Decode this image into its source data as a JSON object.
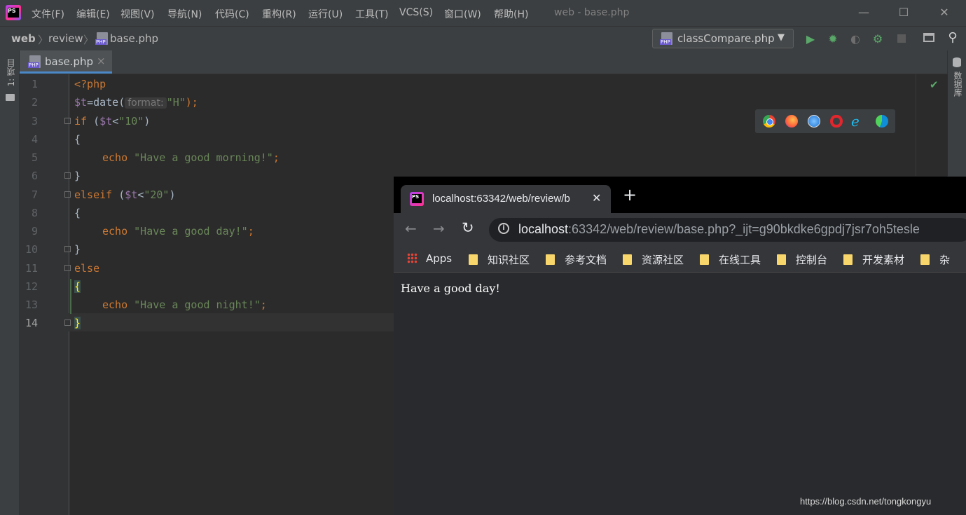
{
  "window": {
    "title": "web - base.php",
    "logo_text": "PS",
    "controls": {
      "minimize": "—",
      "maximize": "☐",
      "close": "✕"
    }
  },
  "menu": [
    "文件(F)",
    "编辑(E)",
    "视图(V)",
    "导航(N)",
    "代码(C)",
    "重构(R)",
    "运行(U)",
    "工具(T)",
    "VCS(S)",
    "窗口(W)",
    "帮助(H)"
  ],
  "breadcrumb": {
    "project": "web",
    "folder": "review",
    "file": "base.php"
  },
  "run_config": {
    "label": "classCompare.php"
  },
  "toolbar_icons": [
    "run-icon",
    "debug-icon",
    "coverage-icon",
    "profile-icon",
    "stop-icon",
    "terminal-icon",
    "search-icon"
  ],
  "left_panel": {
    "label": "1: 项目"
  },
  "right_panel": {
    "label": "数据库"
  },
  "editor": {
    "tab": {
      "label": "base.php",
      "close": "×"
    },
    "lines": [
      "1",
      "2",
      "3",
      "4",
      "5",
      "6",
      "7",
      "8",
      "9",
      "10",
      "11",
      "12",
      "13",
      "14"
    ],
    "code": {
      "l1": "<?php",
      "l2_var": "$t",
      "l2_fn": "=date(",
      "l2_hint": "format:",
      "l2_str": "\"H\"",
      "l2_end": ");",
      "l3_kw": "if",
      "l3_open": " (",
      "l3_var": "$t",
      "l3_op": "<",
      "l3_str": "\"10\"",
      "l3_close": ")",
      "l4": "{",
      "l5_kw": "echo",
      "l5_str": "\"Have a good morning!\"",
      "l5_end": ";",
      "l6": "}",
      "l7_kw": "elseif",
      "l7_open": " (",
      "l7_var": "$t",
      "l7_op": "<",
      "l7_str": "\"20\"",
      "l7_close": ")",
      "l8": "{",
      "l9_kw": "echo",
      "l9_str": "\"Have a good day!\"",
      "l9_end": ";",
      "l10": "}",
      "l11_kw": "else",
      "l12": "{",
      "l13_kw": "echo",
      "l13_str": "\"Have a good night!\"",
      "l13_end": ";",
      "l14": "}"
    },
    "inspection_status": "✔"
  },
  "browser_popup": [
    "chrome-icon",
    "firefox-icon",
    "safari-icon",
    "opera-icon",
    "ie-icon",
    "edge-icon"
  ],
  "browser": {
    "tab_title": "localhost:63342/web/review/b",
    "tab_close": "✕",
    "new_tab": "+",
    "url_host": "localhost",
    "url_rest": ":63342/web/review/base.php?_ijt=g90bkdke6gpdj7jsr7oh5tesle",
    "bookmarks": [
      "Apps",
      "知识社区",
      "参考文档",
      "资源社区",
      "在线工具",
      "控制台",
      "开发素材",
      "杂"
    ],
    "page_text": "Have a good day!"
  },
  "watermark": "https://blog.csdn.net/tongkongyu",
  "colors": {
    "keyword": "#cc7832",
    "variable": "#9876aa",
    "string": "#6a8759",
    "text": "#a9b7c6",
    "accent": "#4a88c7"
  }
}
